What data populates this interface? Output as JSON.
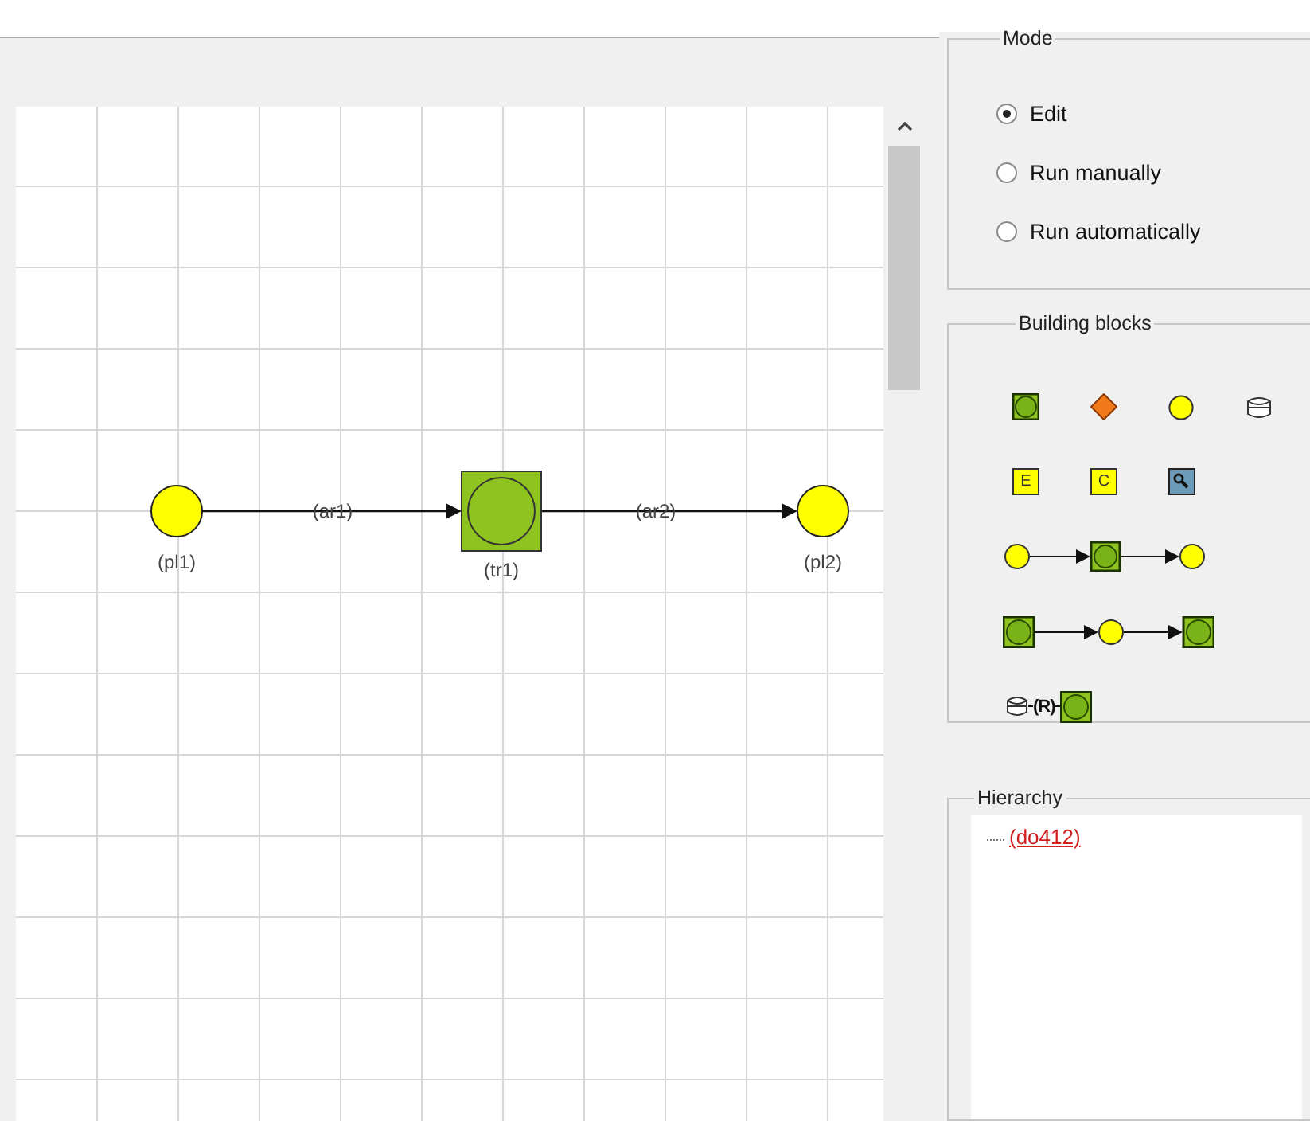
{
  "diagram": {
    "nodes": [
      {
        "kind": "place",
        "label": "(pl1)"
      },
      {
        "kind": "transition",
        "label": "(tr1)"
      },
      {
        "kind": "place",
        "label": "(pl2)"
      }
    ],
    "arcs": [
      {
        "label": "(ar1)"
      },
      {
        "label": "(ar2)"
      }
    ]
  },
  "mode": {
    "title": "Mode",
    "options": [
      {
        "label": "Edit",
        "selected": true
      },
      {
        "label": "Run manually",
        "selected": false
      },
      {
        "label": "Run automatically",
        "selected": false
      }
    ]
  },
  "building_blocks": {
    "title": "Building blocks",
    "rows": [
      [
        {
          "kind": "transition"
        },
        {
          "kind": "diamond"
        },
        {
          "kind": "place"
        },
        {
          "kind": "database"
        }
      ],
      [
        {
          "kind": "letter",
          "text": "E"
        },
        {
          "kind": "letter",
          "text": "C"
        },
        {
          "kind": "inspect"
        }
      ],
      [
        {
          "kind": "place-transition-place"
        }
      ],
      [
        {
          "kind": "transition-place-transition"
        }
      ],
      [
        {
          "kind": "database-resource-transition",
          "text": "(R)"
        }
      ]
    ]
  },
  "hierarchy": {
    "title": "Hierarchy",
    "items": [
      {
        "label": "(do412)"
      }
    ]
  }
}
